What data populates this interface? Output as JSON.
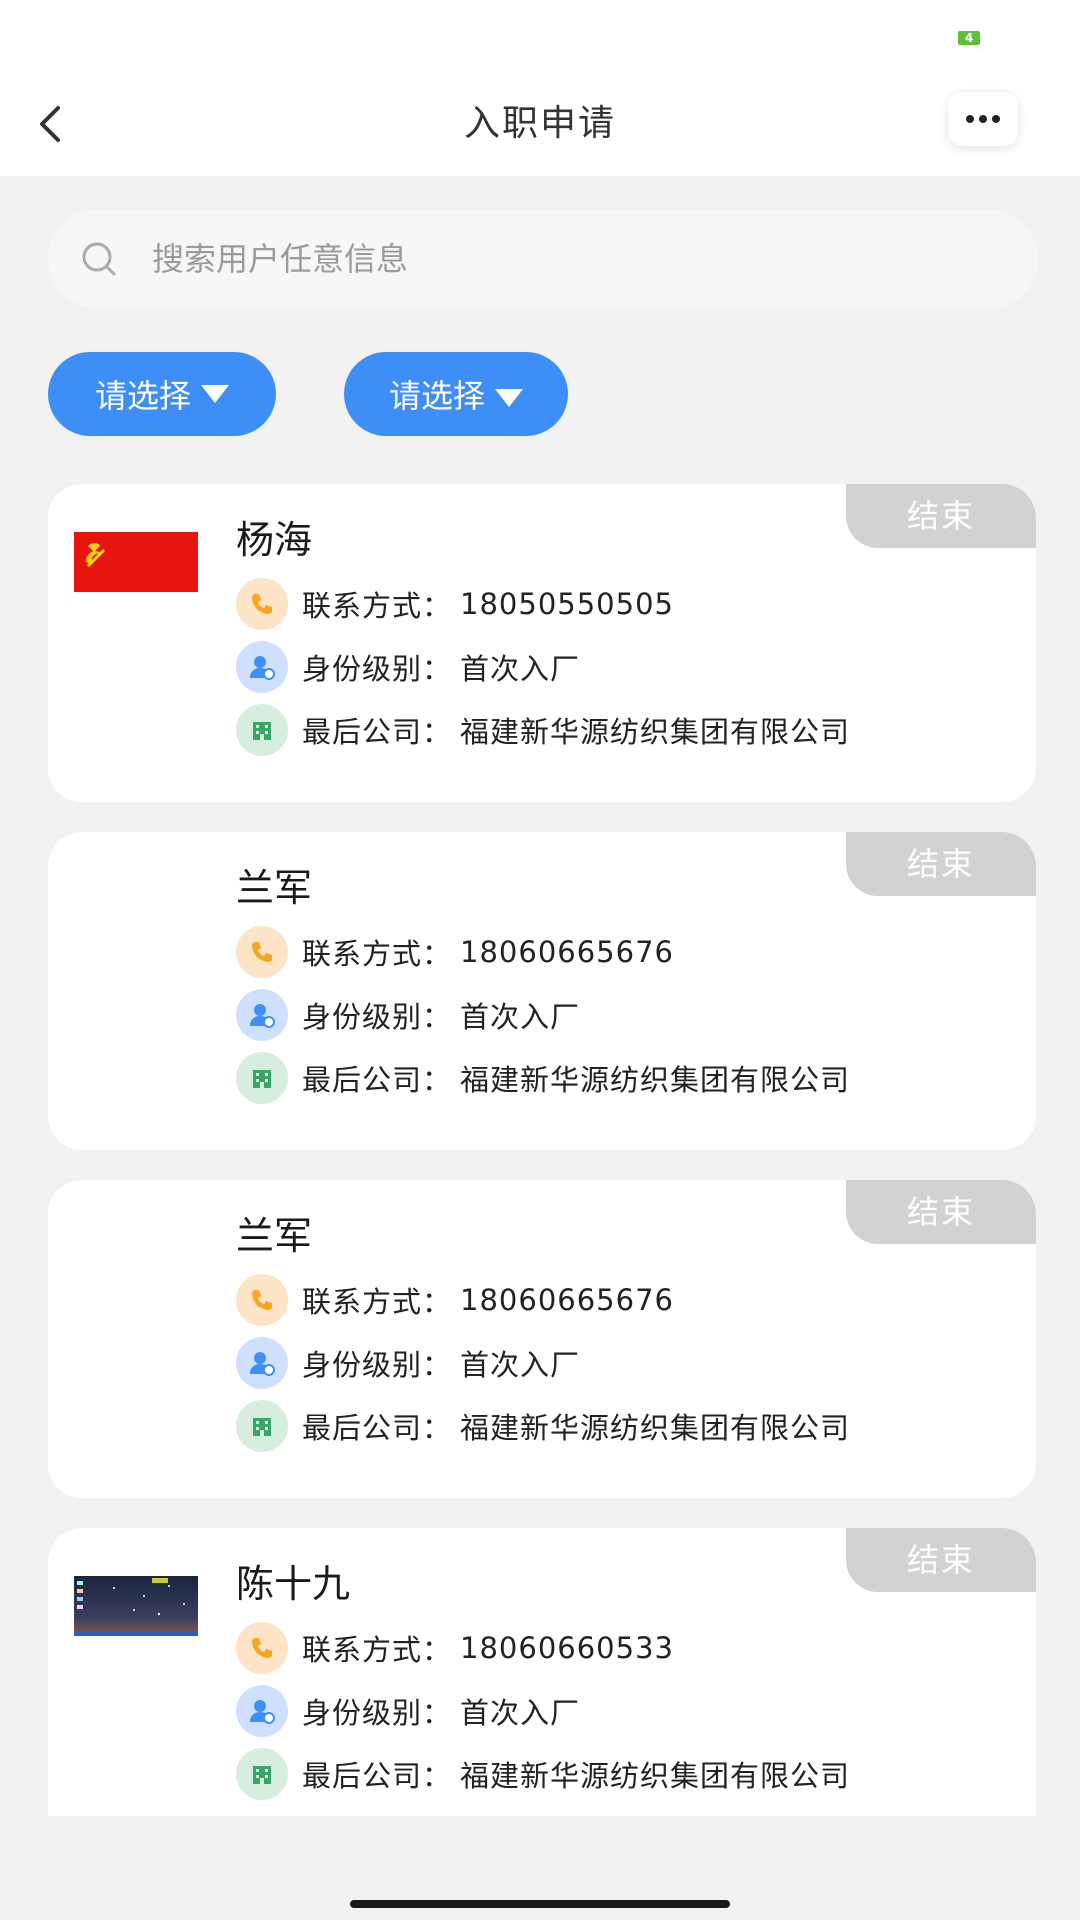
{
  "status_bar": {
    "battery": "4"
  },
  "header": {
    "title": "入职申请"
  },
  "search": {
    "placeholder": "搜索用户任意信息"
  },
  "filters": [
    {
      "label": "请选择"
    },
    {
      "label": "请选择"
    }
  ],
  "cards": [
    {
      "name": "杨海",
      "status": "结束",
      "avatar": "flag-image",
      "contact_label": "联系方式：",
      "contact": "18050550505",
      "level_label": "身份级别：",
      "level": "首次入厂",
      "company_label": "最后公司：",
      "company": "福建新华源纺织集团有限公司"
    },
    {
      "name": "兰军",
      "status": "结束",
      "avatar": "none",
      "contact_label": "联系方式：",
      "contact": "18060665676",
      "level_label": "身份级别：",
      "level": "首次入厂",
      "company_label": "最后公司：",
      "company": "福建新华源纺织集团有限公司"
    },
    {
      "name": "兰军",
      "status": "结束",
      "avatar": "none",
      "contact_label": "联系方式：",
      "contact": "18060665676",
      "level_label": "身份级别：",
      "level": "首次入厂",
      "company_label": "最后公司：",
      "company": "福建新华源纺织集团有限公司"
    },
    {
      "name": "陈十九",
      "status": "结束",
      "avatar": "screenshot-image",
      "contact_label": "联系方式：",
      "contact": "18060660533",
      "level_label": "身份级别：",
      "level": "首次入厂",
      "company_label": "最后公司：",
      "company": "福建新华源纺织集团有限公司"
    }
  ],
  "colors": {
    "accent": "#3e8ef7",
    "tag_bg": "#d2d2d2",
    "phone_icon_bg": "#fde4c7",
    "user_icon_bg": "#cfe0ff",
    "company_icon_bg": "#d5eedd"
  }
}
